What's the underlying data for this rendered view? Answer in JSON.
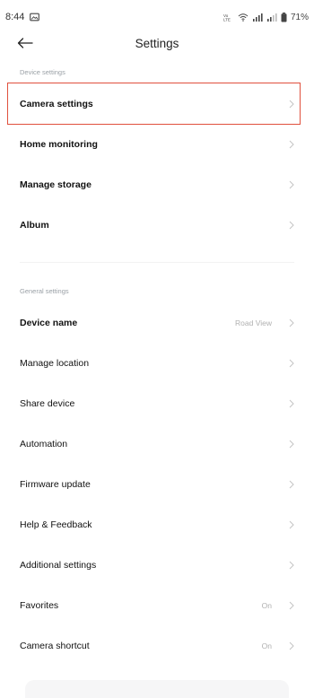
{
  "status_bar": {
    "time": "8:44",
    "battery": "71%",
    "network_label": "VoLTE",
    "icons": [
      "gallery-icon",
      "vowifi-icon",
      "wifi-icon",
      "signal-icon",
      "signal-icon",
      "battery-icon"
    ]
  },
  "header": {
    "title": "Settings",
    "back_icon": "arrow-left-icon"
  },
  "device_settings": {
    "header": "Device settings",
    "items": [
      {
        "label": "Camera settings",
        "value": ""
      },
      {
        "label": "Home monitoring",
        "value": ""
      },
      {
        "label": "Manage storage",
        "value": ""
      },
      {
        "label": "Album",
        "value": ""
      }
    ]
  },
  "general_settings": {
    "header": "General settings",
    "items": [
      {
        "label": "Device name",
        "value": "Road View"
      },
      {
        "label": "Manage location",
        "value": ""
      },
      {
        "label": "Share device",
        "value": ""
      },
      {
        "label": "Automation",
        "value": ""
      },
      {
        "label": "Firmware update",
        "value": ""
      },
      {
        "label": "Help & Feedback",
        "value": ""
      },
      {
        "label": "Additional settings",
        "value": ""
      },
      {
        "label": "Favorites",
        "value": "On"
      },
      {
        "label": "Camera shortcut",
        "value": "On"
      }
    ]
  },
  "colors": {
    "highlight_border": "#e0503d",
    "section_header": "#9aa0a6",
    "value_text": "#b0b0b0",
    "chevron": "#c4c4c4"
  }
}
